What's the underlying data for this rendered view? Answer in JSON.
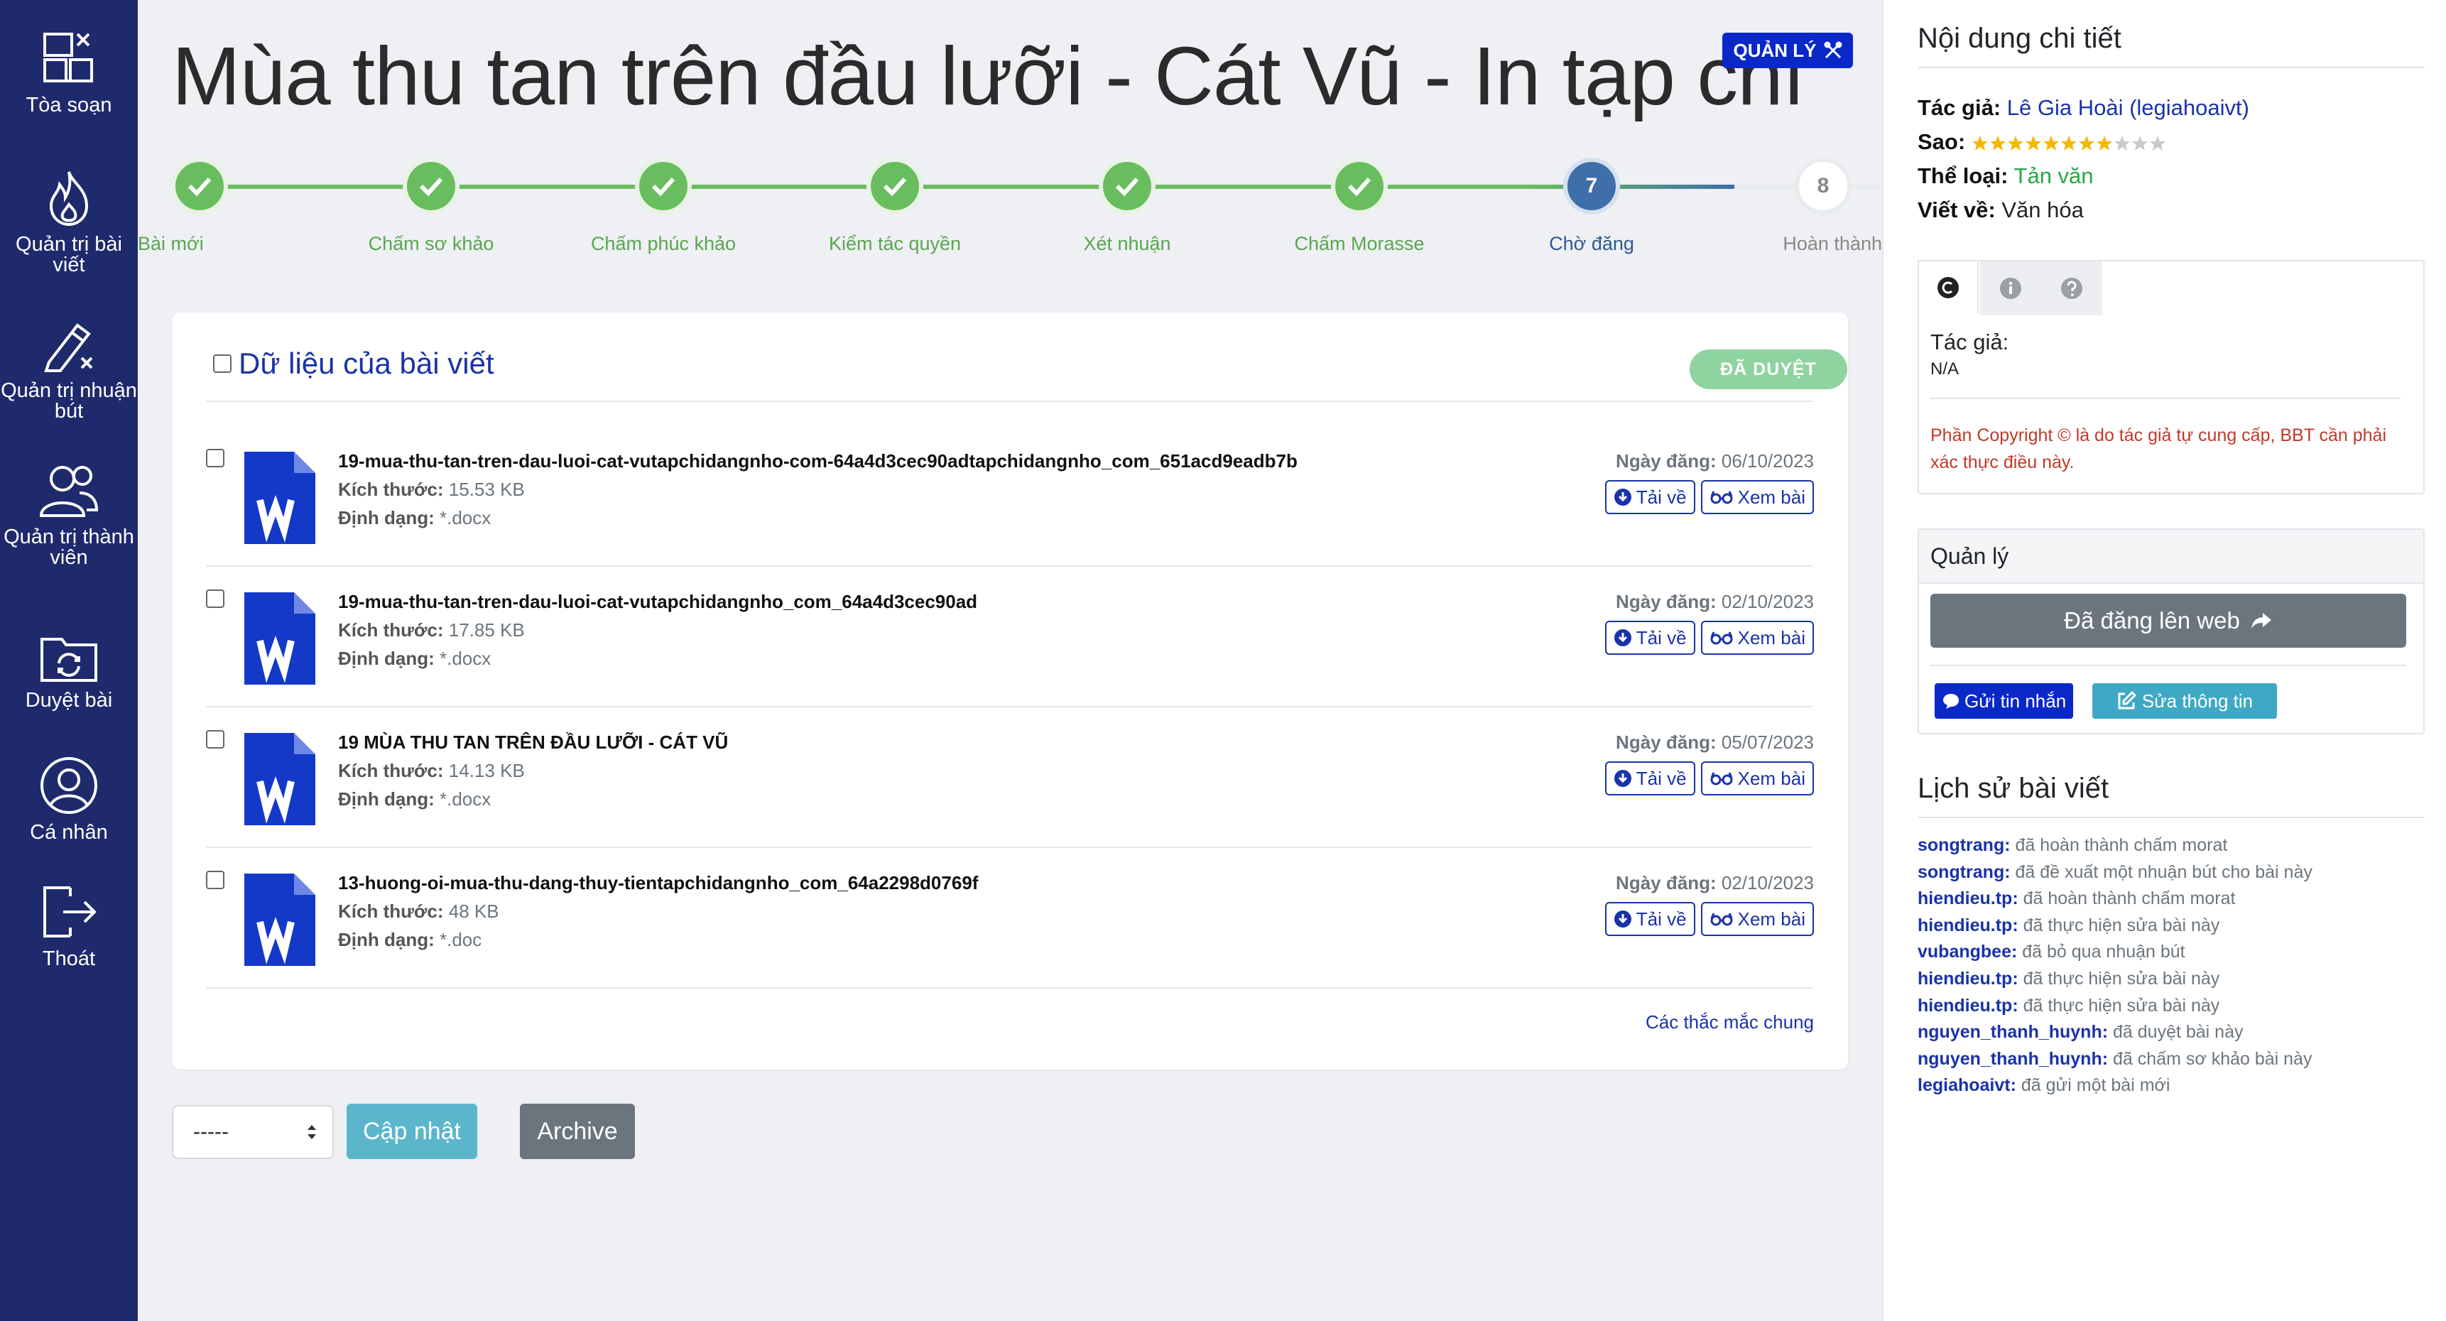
{
  "sidebar": {
    "items": [
      {
        "label": "Tòa soạn",
        "icon": "newsroom-icon"
      },
      {
        "label": "Quản trị bài viết",
        "icon": "fire-icon"
      },
      {
        "label": "Quản trị nhuận bút",
        "icon": "pen-icon"
      },
      {
        "label": "Quản trị thành viên",
        "icon": "users-icon"
      },
      {
        "label": "Duyệt bài",
        "icon": "folder-sync-icon"
      },
      {
        "label": "Cá nhân",
        "icon": "user-circle-icon"
      },
      {
        "label": "Thoát",
        "icon": "logout-icon"
      }
    ]
  },
  "header": {
    "title": "Mùa thu tan trên đầu lưỡi - Cát Vũ - In tạp chí",
    "manage_label": "QUẢN LÝ"
  },
  "stepper": {
    "steps": [
      {
        "label": "Bài mới",
        "status": "done"
      },
      {
        "label": "Chấm sơ khảo",
        "status": "done"
      },
      {
        "label": "Chấm phúc khảo",
        "status": "done"
      },
      {
        "label": "Kiểm tác quyền",
        "status": "done"
      },
      {
        "label": "Xét nhuận",
        "status": "done"
      },
      {
        "label": "Chấm Morasse",
        "status": "done"
      },
      {
        "label": "Chờ đăng",
        "status": "current",
        "number": "7"
      },
      {
        "label": "Hoàn thành",
        "status": "pending",
        "number": "8"
      }
    ],
    "colors": {
      "done": "#6abd5e",
      "current": "#3f6fa8",
      "pending": "#e9ecef"
    }
  },
  "data_card": {
    "title": "Dữ liệu của bài viết",
    "badge": "ĐÃ DUYỆT",
    "size_label": "Kích thước:",
    "format_label": "Định dạng:",
    "date_label": "Ngày đăng:",
    "download_label": "Tải về",
    "view_label": "Xem bài",
    "files": [
      {
        "name": "19-mua-thu-tan-tren-dau-luoi-cat-vutapchidangnho-com-64a4d3cec90adtapchidangnho_com_651acd9eadb7b",
        "size": "15.53 KB",
        "format": "*.docx",
        "date": "06/10/2023"
      },
      {
        "name": "19-mua-thu-tan-tren-dau-luoi-cat-vutapchidangnho_com_64a4d3cec90ad",
        "size": "17.85 KB",
        "format": "*.docx",
        "date": "02/10/2023"
      },
      {
        "name": "19 MÙA THU TAN TRÊN ĐẦU LƯỠI - CÁT VŨ",
        "size": "14.13 KB",
        "format": "*.docx",
        "date": "05/07/2023"
      },
      {
        "name": "13-huong-oi-mua-thu-dang-thuy-tientapchidangnho_com_64a2298d0769f",
        "size": "48 KB",
        "format": "*.doc",
        "date": "02/10/2023"
      }
    ],
    "faq_link": "Các thắc mắc chung"
  },
  "bottom": {
    "select_value": "-----",
    "update_label": "Cập nhật",
    "archive_label": "Archive"
  },
  "right_panel": {
    "detail_title": "Nội dung chi tiết",
    "author_label": "Tác giả:",
    "author_value": "Lê Gia Hoài (legiahoaivt)",
    "stars_label": "Sao:",
    "stars_filled": 8,
    "stars_total": 11,
    "category_label": "Thể loại:",
    "category_value": "Tản văn",
    "topic_label": "Viết về:",
    "topic_value": "Văn hóa",
    "tab_author_label": "Tác giả:",
    "tab_author_value": "N/A",
    "copyright_note": "Phần Copyright © là do tác giả tự cung cấp, BBT cần phải xác thực điều này.",
    "manage_title": "Quản lý",
    "publish_label": "Đã đăng lên web",
    "message_label": "Gửi tin nhắn",
    "edit_label": "Sửa thông tin",
    "history_title": "Lịch sử bài viết",
    "history": [
      {
        "user": "songtrang:",
        "action": "đã hoàn thành chấm morat"
      },
      {
        "user": "songtrang:",
        "action": "đã đề xuất một nhuận bút cho bài này"
      },
      {
        "user": "hiendieu.tp:",
        "action": "đã hoàn thành chấm morat"
      },
      {
        "user": "hiendieu.tp:",
        "action": "đã thực hiện sửa bài này"
      },
      {
        "user": "vubangbee:",
        "action": "đã bỏ qua nhuận bút"
      },
      {
        "user": "hiendieu.tp:",
        "action": "đã thực hiện sửa bài này"
      },
      {
        "user": "hiendieu.tp:",
        "action": "đã thực hiện sửa bài này"
      },
      {
        "user": "nguyen_thanh_huynh:",
        "action": "đã duyệt bài này"
      },
      {
        "user": "nguyen_thanh_huynh:",
        "action": "đã chấm sơ khảo bài này"
      },
      {
        "user": "legiahoaivt:",
        "action": "đã gửi một bài mới"
      }
    ]
  }
}
